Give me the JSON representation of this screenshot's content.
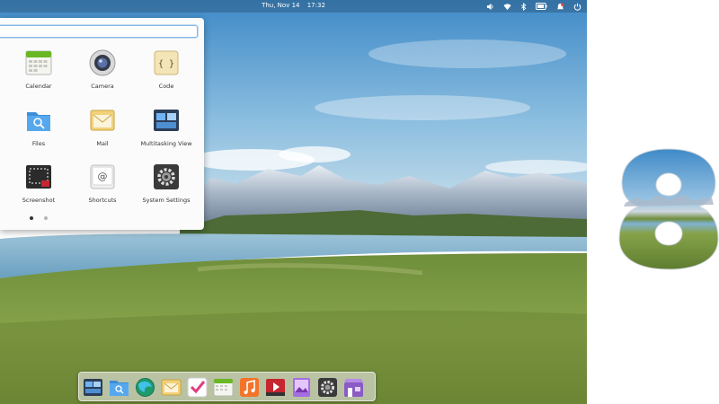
{
  "topbar": {
    "date": "Thu, Nov 14",
    "time": "17:32"
  },
  "search": {
    "placeholder": ""
  },
  "apps": [
    {
      "label": "Calendar",
      "icon": "calendar-icon"
    },
    {
      "label": "Camera",
      "icon": "camera-icon"
    },
    {
      "label": "Code",
      "icon": "code-icon"
    },
    {
      "label": "Files",
      "icon": "files-icon"
    },
    {
      "label": "Mail",
      "icon": "mail-icon"
    },
    {
      "label": "Multitasking View",
      "icon": "multitasking-icon"
    },
    {
      "label": "Screenshot",
      "icon": "screenshot-icon"
    },
    {
      "label": "Shortcuts",
      "icon": "shortcuts-icon"
    },
    {
      "label": "System Settings",
      "icon": "settings-icon"
    }
  ],
  "pages": {
    "count": 2,
    "current": 1
  },
  "dock": [
    "multitasking-icon",
    "files-icon",
    "web-browser-icon",
    "mail-icon",
    "tasks-icon",
    "calendar-icon",
    "music-icon",
    "videos-icon",
    "photos-icon",
    "settings-icon",
    "appcenter-icon"
  ],
  "colors": {
    "accent": "#3689e6",
    "menu_bg": "#fbfbfb",
    "sky": "#5aa0d2",
    "grass": "#7c9a3e"
  }
}
